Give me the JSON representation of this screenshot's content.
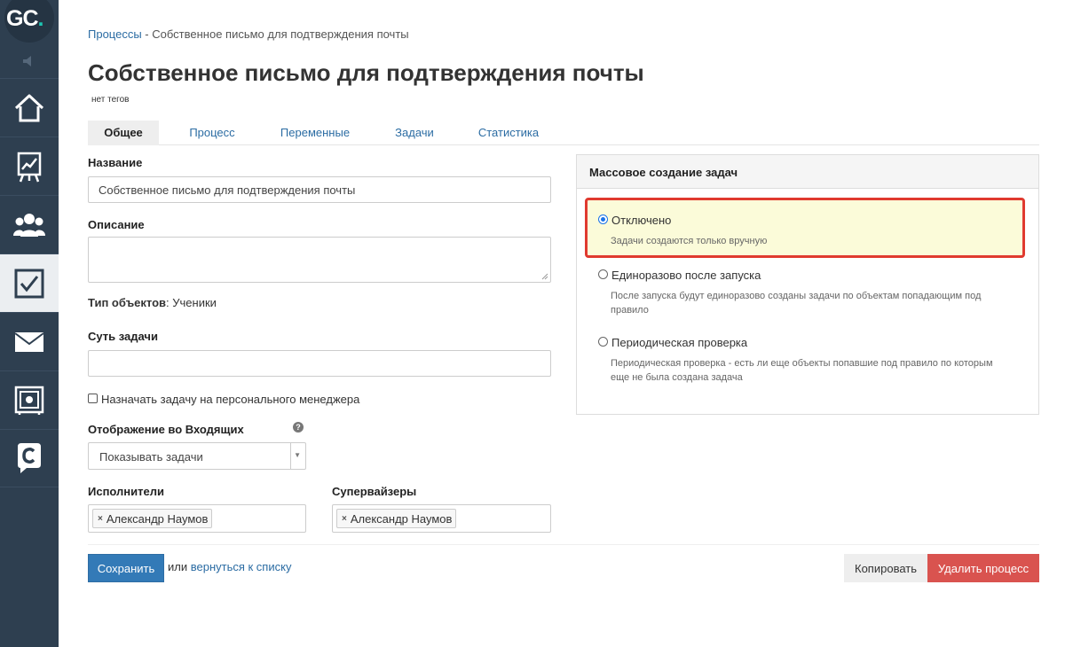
{
  "sidebar": {
    "logo": {
      "text_main": "GC",
      "text_dot": "."
    },
    "items": [
      {
        "id": "home",
        "icon": "home-icon"
      },
      {
        "id": "analytics",
        "icon": "chart-board-icon"
      },
      {
        "id": "users",
        "icon": "users-icon"
      },
      {
        "id": "tasks",
        "icon": "checkbox-icon",
        "active": true
      },
      {
        "id": "mail",
        "icon": "mail-icon"
      },
      {
        "id": "safe",
        "icon": "safe-icon"
      },
      {
        "id": "chat",
        "icon": "chat-c-icon"
      }
    ]
  },
  "breadcrumb": {
    "parent": "Процессы",
    "separator": " - ",
    "current": "Собственное письмо для подтверждения почты"
  },
  "page": {
    "title": "Собственное письмо для подтверждения почты",
    "tags": "нет тегов"
  },
  "tabs": [
    {
      "label": "Общее",
      "active": true
    },
    {
      "label": "Процесс"
    },
    {
      "label": "Переменные"
    },
    {
      "label": "Задачи"
    },
    {
      "label": "Статистика"
    }
  ],
  "form": {
    "name_label": "Название",
    "name_value": "Собственное письмо для подтверждения почты",
    "description_label": "Описание",
    "description_value": "",
    "object_type_label": "Тип объектов",
    "object_type_value": ": Ученики",
    "task_essence_label": "Суть задачи",
    "task_essence_value": "",
    "assign_manager_label": "Назначать задачу на персонального менеджера",
    "assign_manager_checked": false,
    "inbox_label": "Отображение во Входящих",
    "inbox_help": "?",
    "inbox_value": "Показывать задачи",
    "executors_label": "Исполнители",
    "executors": [
      "Александр Наумов"
    ],
    "supervisors_label": "Супервайзеры",
    "supervisors": [
      "Александр Наумов"
    ],
    "tag_remove": "×"
  },
  "actions": {
    "save": "Сохранить",
    "or": "или",
    "back_link": "вернуться к списку",
    "copy": "Копировать",
    "delete": "Удалить процесс"
  },
  "mass_panel": {
    "title": "Массовое создание задач",
    "options": [
      {
        "label": "Отключено",
        "desc": "Задачи создаются только вручную",
        "checked": true
      },
      {
        "label": "Единоразово после запуска",
        "desc": "После запуска будут единоразово созданы задачи по объектам попадающим под правило",
        "checked": false
      },
      {
        "label": "Периодическая проверка",
        "desc": "Периодическая проверка - есть ли еще объекты попавшие под правило по которым еще не была создана задача",
        "checked": false
      }
    ]
  },
  "colors": {
    "sidebar_bg": "#2e3f50",
    "link": "#2b6ca3",
    "primary": "#337ab7",
    "danger": "#d9534f",
    "highlight_border": "#e03a2f",
    "highlight_bg": "#fbfbd9",
    "logo_accent": "#1dc6b2"
  }
}
